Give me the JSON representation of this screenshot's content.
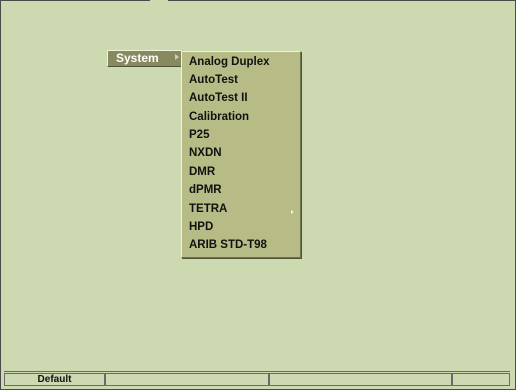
{
  "menu": {
    "root_label": "System",
    "submenu_items": [
      {
        "label": "Analog Duplex",
        "has_submenu": false
      },
      {
        "label": "AutoTest",
        "has_submenu": false
      },
      {
        "label": "AutoTest II",
        "has_submenu": false
      },
      {
        "label": "Calibration",
        "has_submenu": false
      },
      {
        "label": "P25",
        "has_submenu": false
      },
      {
        "label": "NXDN",
        "has_submenu": false
      },
      {
        "label": "DMR",
        "has_submenu": false
      },
      {
        "label": "dPMR",
        "has_submenu": false
      },
      {
        "label": "TETRA",
        "has_submenu": true
      },
      {
        "label": "HPD",
        "has_submenu": false
      },
      {
        "label": "ARIB STD-T98",
        "has_submenu": false
      }
    ]
  },
  "statusbar": {
    "cells": [
      "Default",
      "",
      "",
      ""
    ]
  },
  "colors": {
    "background": "#cdd9b1",
    "menu_root": "#878a5f",
    "submenu_bg": "#b7bb86"
  }
}
